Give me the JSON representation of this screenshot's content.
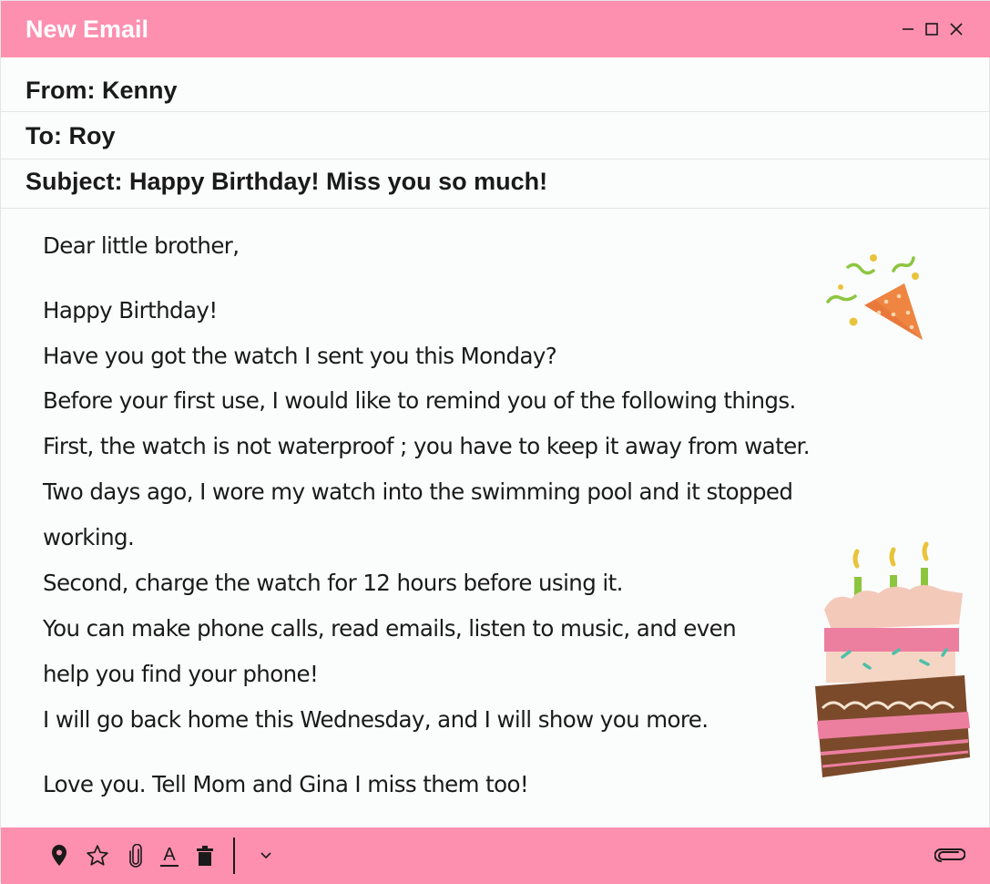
{
  "window": {
    "title": "New Email",
    "controls": [
      "minimize-icon",
      "maximize-icon",
      "close-icon"
    ]
  },
  "header": {
    "from": "From: Kenny",
    "to": "To: Roy",
    "subject": "Subject: Happy Birthday! Miss you so much!"
  },
  "body": {
    "lines": [
      "Dear little brother,",
      "Happy Birthday!",
      "Have you got the watch I sent you this Monday?",
      "Before your first use, I would like to remind you of the following things.",
      "First, the watch is not waterproof ; you have to keep it away from water.",
      "Two days ago, I wore my watch into the swimming pool and it stopped",
      "working.",
      "Second, charge the watch for 12 hours before using it.",
      "You can make phone calls, read emails, listen to music, and even",
      "help you find your phone!",
      "I will go back home this Wednesday, and I will show you more.",
      "Love you. Tell Mom and Gina I miss them too!"
    ],
    "decorations": [
      "party-popper-icon",
      "birthday-cake-icon"
    ]
  },
  "toolbar": {
    "icons": [
      "location-pin-icon",
      "star-icon",
      "attachment-icon",
      "text-format-icon",
      "trash-icon",
      "chevron-down-icon",
      "paperclip-icon"
    ]
  },
  "colors": {
    "accent": "#fd8faf",
    "text": "#1a1a1a",
    "background": "#fbfcfc"
  }
}
